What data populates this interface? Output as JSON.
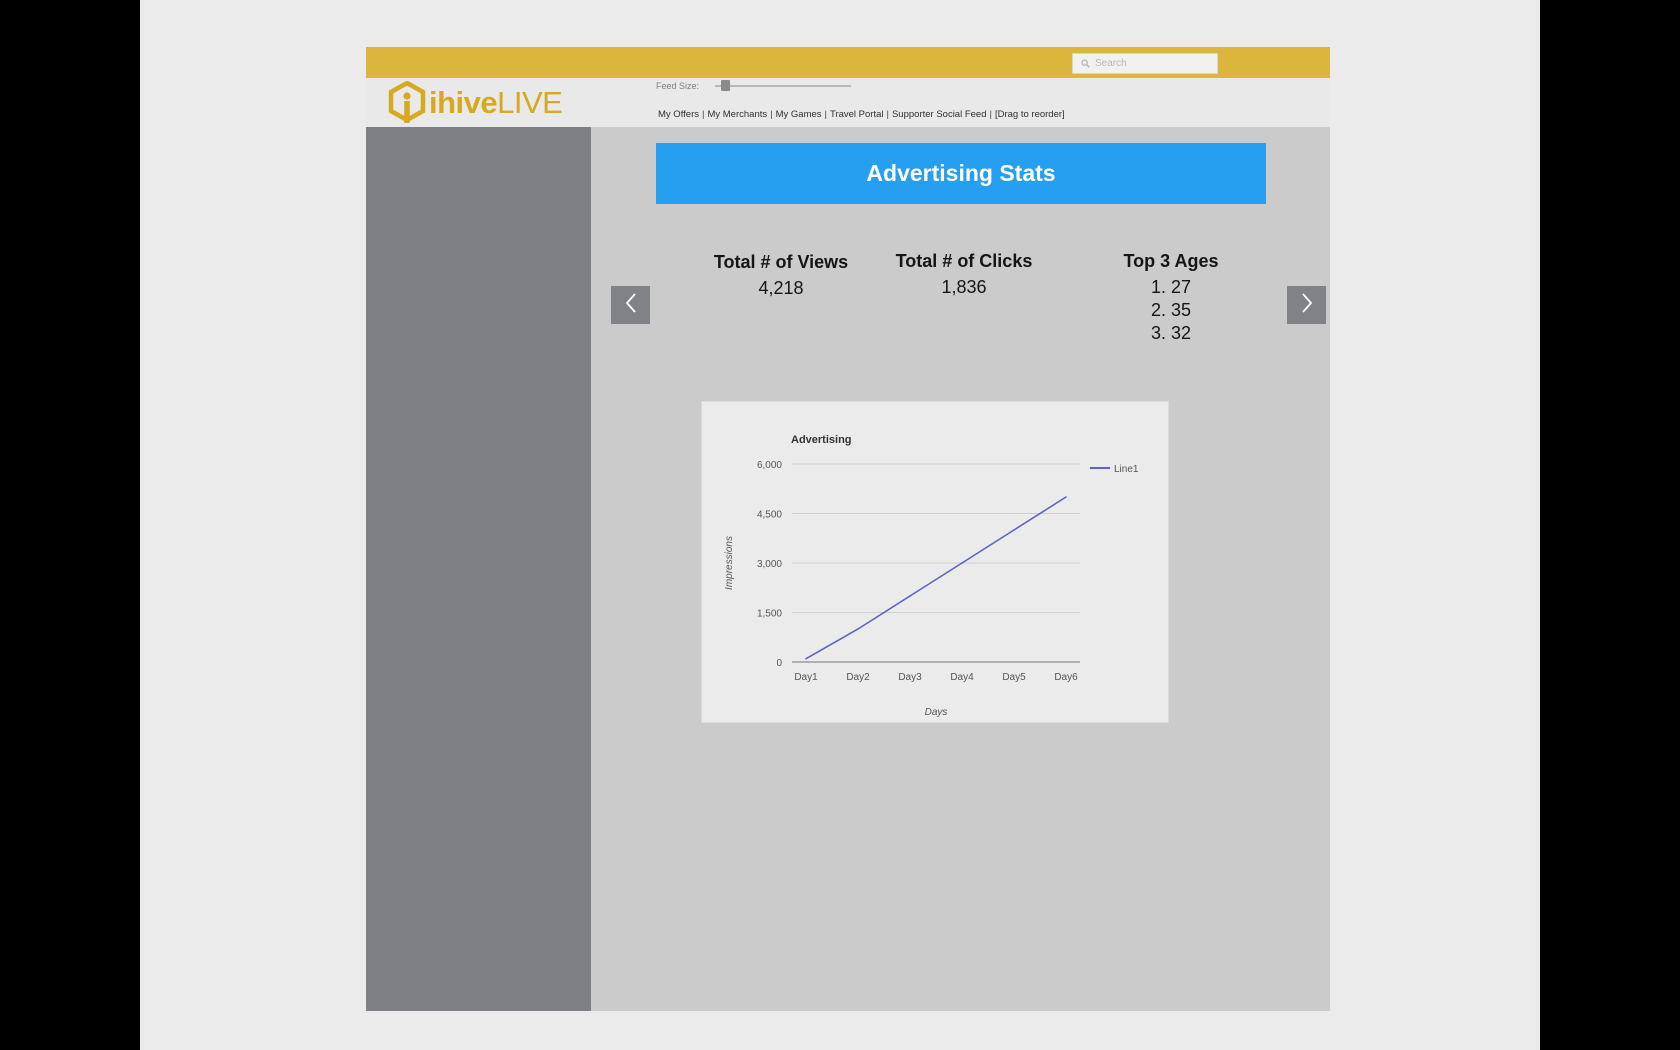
{
  "search": {
    "placeholder": "Search"
  },
  "brand": {
    "logo_text_1": "ihive",
    "logo_text_2": "LIVE"
  },
  "feed_size": {
    "label": "Feed Size:",
    "value": 0.05
  },
  "nav": {
    "links": [
      "My Offers",
      "My Merchants",
      "My Games",
      "Travel Portal",
      "Supporter Social Feed",
      "[Drag to reorder]"
    ]
  },
  "banner": {
    "title": "Advertising Stats"
  },
  "stats": {
    "views": {
      "title": "Total # of Views",
      "value": "4,218"
    },
    "clicks": {
      "title": "Total # of Clicks",
      "value": "1,836"
    },
    "ages": {
      "title": "Top 3 Ages",
      "values": [
        "1. 27",
        "2. 35",
        "3. 32"
      ]
    }
  },
  "colors": {
    "topbar": "#dbb53c",
    "brand": "#d6a91f",
    "banner": "#279ff1",
    "sidebar": "#7f8083",
    "line": "#5b63c7"
  },
  "icons": {
    "search": "search-icon",
    "prev": "chevron-left-icon",
    "next": "chevron-right-icon"
  },
  "chart_data": {
    "type": "line",
    "title": "Advertising",
    "xlabel": "Days",
    "ylabel": "Impressions",
    "categories": [
      "Day1",
      "Day2",
      "Day3",
      "Day4",
      "Day5",
      "Day6"
    ],
    "ylim": [
      0,
      6000
    ],
    "yticks": [
      0,
      1500,
      3000,
      4500,
      6000
    ],
    "ytick_labels": [
      "0",
      "1,500",
      "3,000",
      "4,500",
      "6,000"
    ],
    "grid": true,
    "legend": "right",
    "series": [
      {
        "name": "Line1",
        "values": [
          100,
          1000,
          2000,
          3000,
          4000,
          5000
        ]
      }
    ]
  }
}
